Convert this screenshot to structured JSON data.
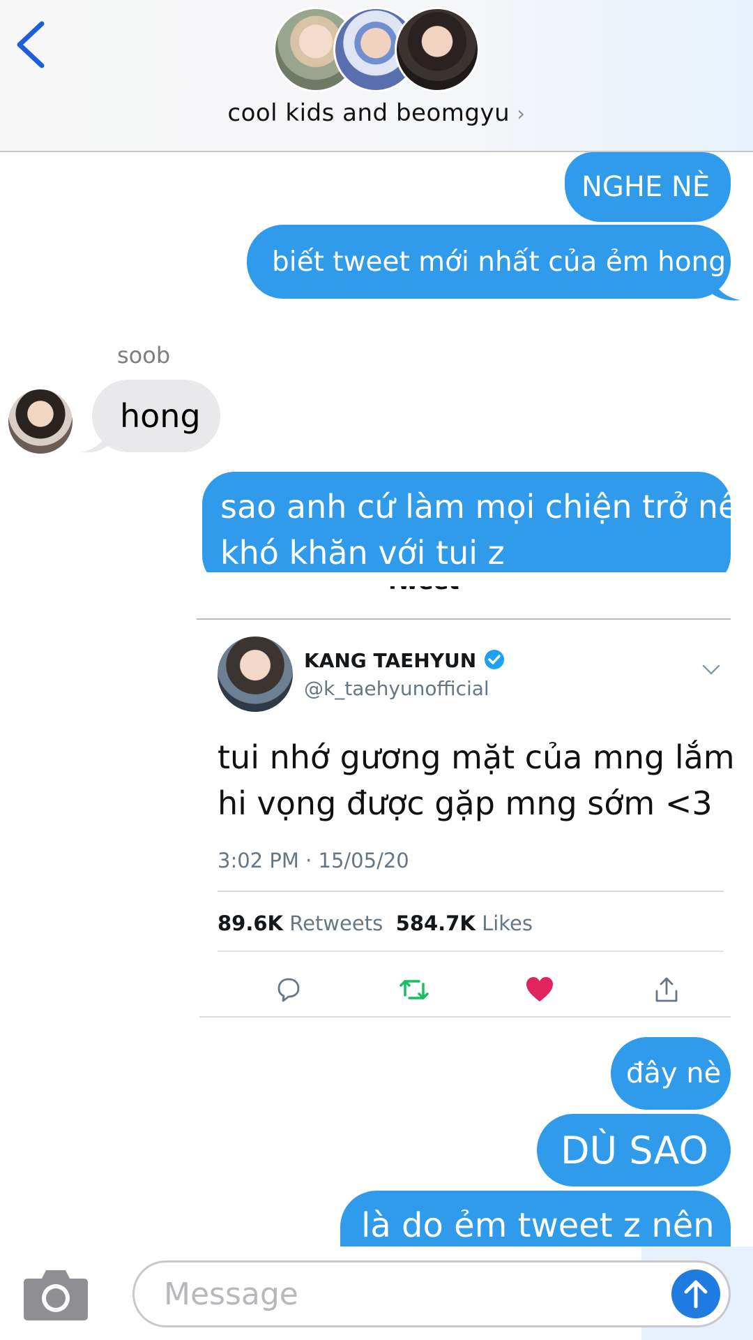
{
  "header": {
    "group_name": "cool kids and beomgyu",
    "chevron": "›",
    "avatars": [
      "member-avatar",
      "member-avatar",
      "member-avatar"
    ]
  },
  "messages": [
    {
      "side": "out",
      "text": "NGHE NÈ"
    },
    {
      "side": "out",
      "text": "biết tweet mới nhất của ẻm hong"
    },
    {
      "side": "in",
      "sender": "soob",
      "text": "hong"
    },
    {
      "side": "out",
      "lines": [
        "sao anh cứ làm mọi chiện trở nên",
        "khó khăn với tui z"
      ]
    },
    {
      "side": "out",
      "text": "đây nè"
    },
    {
      "side": "out",
      "text": "DÙ SAO"
    },
    {
      "side": "out",
      "text": "là do ẻm tweet z nên"
    }
  ],
  "tweet": {
    "header_cut": "Tweet",
    "name": "KANG TAEHYUN",
    "handle": "@k_taehyunofficial",
    "body_lines": [
      "tui nhớ gương mặt của mng lắm",
      "hi vọng được gặp mng sớm <3"
    ],
    "time": "3:02 PM · 15/05/20",
    "retweets_count": "89.6K",
    "retweets_label": "Retweets",
    "likes_count": "584.7K",
    "likes_label": "Likes"
  },
  "compose": {
    "placeholder": "Message"
  },
  "colors": {
    "outgoing_bubble": "#2f9bea",
    "incoming_bubble": "#e9e9eb",
    "ios_blue": "#1f7be0",
    "retweet_green": "#17bf63",
    "like_red": "#e0245e"
  }
}
